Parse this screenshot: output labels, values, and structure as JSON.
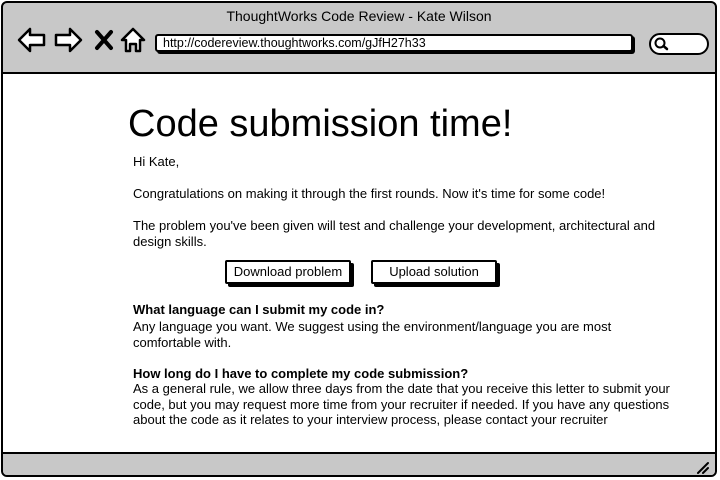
{
  "window": {
    "title": "ThoughtWorks Code Review - Kate Wilson"
  },
  "browser": {
    "url": "http://codereview.thoughtworks.com/gJfH27h33",
    "icons": [
      "back-arrow-icon",
      "forward-arrow-icon",
      "close-icon",
      "home-icon",
      "search-icon",
      "resize-grip-icon"
    ]
  },
  "page": {
    "title": "Code submission time!",
    "greeting": "Hi Kate,",
    "congrats": "Congratulations on making it through the first rounds. Now it's time for some code!",
    "intro": "The problem you've been given will test and challenge your development, architectural and design skills.",
    "buttons": {
      "download": "Download problem",
      "upload": "Upload solution"
    },
    "faq": [
      {
        "question": "What language can I submit my code in?",
        "answer": "Any language you want. We suggest using the environment/language you are most comfortable with."
      },
      {
        "question": "How long do I have to complete my code submission?",
        "answer": "As a general rule, we allow three days from the date that you receive this letter to submit your code, but you may request more time from your recruiter if needed.  If you have any questions about the code as it relates to your interview process, please contact your recruiter"
      }
    ]
  }
}
